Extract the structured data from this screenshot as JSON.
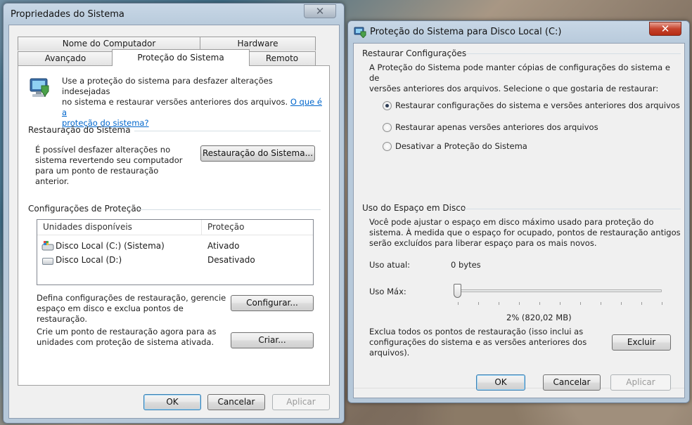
{
  "left_window": {
    "title": "Propriedades do Sistema",
    "tabs_row1": [
      "Nome do Computador",
      "Hardware"
    ],
    "tabs_row2": [
      "Avançado",
      "Proteção do Sistema",
      "Remoto"
    ],
    "intro_text_1": "Use a proteção do sistema para desfazer alterações indesejadas",
    "intro_text_2": "no sistema e restaurar versões anteriores dos arquivos. ",
    "intro_link_1": "O que é a",
    "intro_link_2": "proteção do sistema?",
    "restore_section": "Restauração do Sistema",
    "restore_text": [
      "É possível desfazer alterações no",
      "sistema revertendo seu computador",
      "para um ponto de restauração",
      "anterior."
    ],
    "restore_button": "Restauração do Sistema...",
    "protection_section": "Configurações de Proteção",
    "table": {
      "columns": [
        "Unidades disponíveis",
        "Proteção"
      ],
      "rows": [
        {
          "drive": "Disco Local (C:) (Sistema)",
          "status": "Ativado"
        },
        {
          "drive": "Disco Local (D:)",
          "status": "Desativado"
        }
      ]
    },
    "configure_text": [
      "Defina configurações de restauração, gerencie",
      "espaço em disco e exclua pontos de",
      "restauração."
    ],
    "configure_button": "Configurar...",
    "create_text": [
      "Crie um ponto de restauração agora para as",
      "unidades com proteção de sistema ativada."
    ],
    "create_button": "Criar...",
    "ok": "OK",
    "cancel": "Cancelar",
    "apply": "Aplicar"
  },
  "right_window": {
    "title": "Proteção do Sistema para Disco Local (C:)",
    "restore_section": "Restaurar Configurações",
    "restore_text": [
      "A Proteção do Sistema pode manter cópias de configurações do sistema e de",
      "versões anteriores dos arquivos. Selecione o que gostaria de restaurar:"
    ],
    "options": [
      {
        "label": "Restaurar configurações do sistema e versões anteriores dos arquivos",
        "selected": true
      },
      {
        "label": "Restaurar apenas versões anteriores dos arquivos",
        "selected": false
      },
      {
        "label": "Desativar a Proteção do Sistema",
        "selected": false
      }
    ],
    "disk_section": "Uso do Espaço em Disco",
    "disk_text": [
      "Você pode ajustar o espaço em disco máximo usado para proteção do",
      "sistema. À medida que o espaço for ocupado, pontos de restauração antigos",
      "serão excluídos para liberar espaço para os mais novos."
    ],
    "current_label": "Uso atual:",
    "current_value": "0 bytes",
    "max_label": "Uso Máx:",
    "slider_value_percent": 2,
    "slider_readout": "2% (820,02 MB)",
    "delete_text": [
      "Exclua todos os pontos de restauração (isso inclui as",
      "configurações do sistema e as versões anteriores dos",
      "arquivos)."
    ],
    "delete_button": "Excluir",
    "ok": "OK",
    "cancel": "Cancelar",
    "apply": "Aplicar"
  }
}
